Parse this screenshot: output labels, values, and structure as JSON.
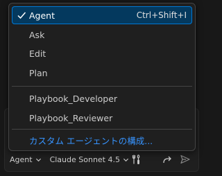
{
  "menu": {
    "items": [
      {
        "label": "Agent",
        "shortcut": "Ctrl+Shift+I",
        "selected": true
      },
      {
        "label": "Ask"
      },
      {
        "label": "Edit"
      },
      {
        "label": "Plan"
      },
      {
        "label": "Playbook_Developer"
      },
      {
        "label": "Playbook_Reviewer"
      },
      {
        "label": "カスタム エージェントの構成..."
      }
    ]
  },
  "toolbar": {
    "mode_label": "Agent",
    "model_label": "Claude Sonnet 4.5"
  },
  "colors": {
    "accent": "#0078d4",
    "selected_bg": "#04395e",
    "link": "#3794ff",
    "menu_bg": "#1f1f1f"
  },
  "icons": [
    "check-icon",
    "chevron-down-icon",
    "tools-icon",
    "redo-icon",
    "send-icon"
  ]
}
